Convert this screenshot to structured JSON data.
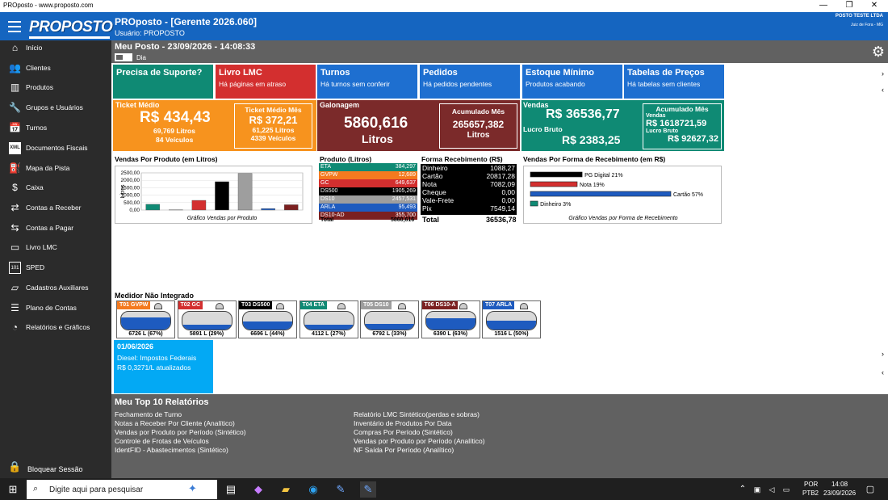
{
  "window": {
    "title": "PROposto - www.proposto.com",
    "minimize": "—",
    "maximize": "❐",
    "close": "✕"
  },
  "header": {
    "logo": "PROPOSTO",
    "title": "PROposto - [Gerente 2026.060]",
    "user": "Usuário: PROPOSTO",
    "company": "POSTO TESTE LTDA",
    "city": "Juiz de Fora - MG"
  },
  "sidebar": {
    "items": [
      {
        "label": "Início",
        "icon": "⌂"
      },
      {
        "label": "Clientes",
        "icon": "👥"
      },
      {
        "label": "Produtos",
        "icon": "▥"
      },
      {
        "label": "Grupos e Usuários",
        "icon": "🔧"
      },
      {
        "label": "Turnos",
        "icon": "📅"
      },
      {
        "label": "Documentos Fiscais",
        "icon": "XML"
      },
      {
        "label": "Mapa da Pista",
        "icon": "⛽"
      },
      {
        "label": "Caixa",
        "icon": "$"
      },
      {
        "label": "Contas a Receber",
        "icon": "⇄"
      },
      {
        "label": "Contas a Pagar",
        "icon": "⇆"
      },
      {
        "label": "Livro LMC",
        "icon": "▭"
      },
      {
        "label": "SPED",
        "icon": "101"
      },
      {
        "label": "Cadastros Auxiliares",
        "icon": "▱"
      },
      {
        "label": "Plano de Contas",
        "icon": "☰"
      },
      {
        "label": "Relatórios e Gráficos",
        "icon": "◔"
      }
    ],
    "lock": "Bloquear Sessão"
  },
  "dashboard": {
    "title": "Meu Posto - 23/09/2026 - 14:08:33",
    "toggle_label": "Dia"
  },
  "cards": [
    {
      "title": "Precisa de Suporte?",
      "sub": ""
    },
    {
      "title": "Livro LMC",
      "sub": "Há páginas em atraso"
    },
    {
      "title": "Turnos",
      "sub": "Há turnos sem conferir"
    },
    {
      "title": "Pedidos",
      "sub": "Há pedidos pendentes"
    },
    {
      "title": "Estoque Mínimo",
      "sub": "Produtos acabando"
    },
    {
      "title": "Tabelas de Preços",
      "sub": "Há tabelas sem clientes"
    }
  ],
  "ticket": {
    "label": "Ticket Médio",
    "value": "R$ 434,43",
    "litros": "69,769 Litros",
    "veiculos": "84 Veículos",
    "mes_label": "Ticket Médio Mês",
    "mes_value": "R$ 372,21",
    "mes_litros": "61,225 Litros",
    "mes_veiculos": "4339 Veículos"
  },
  "galonagem": {
    "label": "Galonagem",
    "value": "5860,616",
    "unit": "Litros",
    "mes_label": "Acumulado Mês",
    "mes_value": "265657,382",
    "mes_unit": "Litros"
  },
  "vendas": {
    "label": "Vendas",
    "value": "R$ 36536,77",
    "lucro_label": "Lucro Bruto",
    "lucro": "R$ 2383,25",
    "mes_label": "Acumulado Mês",
    "mes_vendas_label": "Vendas",
    "mes_vendas": "R$ 1618721,59",
    "mes_lucro_label": "Lucro Bruto",
    "mes_lucro": "R$ 92627,32"
  },
  "chart_produto": {
    "title": "Vendas Por Produto (em Litros)",
    "caption": "Gráfico Vendas por Produto"
  },
  "chart_data": [
    {
      "type": "bar",
      "title": "Vendas Por Produto (em Litros)",
      "ylabel": "Litros",
      "ylim": [
        0,
        2500
      ],
      "yticks": [
        "2500,00",
        "2000,00",
        "1500,00",
        "1000,00",
        "500,00",
        "0,00"
      ],
      "categories": [
        "ETA",
        "GVPW",
        "GC",
        "DS500",
        "DS10",
        "ARLA",
        "DS10-AD"
      ],
      "values": [
        384.297,
        12.689,
        649.637,
        1905.269,
        2457.531,
        95.493,
        355.7
      ],
      "colors": [
        "#0f8a74",
        "#f47a1f",
        "#d32f2f",
        "#000000",
        "#9e9e9e",
        "#1e5bbf",
        "#7b2020"
      ]
    },
    {
      "type": "bar",
      "orientation": "horizontal",
      "title": "Vendas Por Forma de Recebimento (em R$)",
      "categories": [
        "PG Digital",
        "Nota",
        "Cartão",
        "Dinheiro"
      ],
      "values": [
        21,
        19,
        57,
        3
      ],
      "unit": "%",
      "colors": [
        "#000000",
        "#d32f2f",
        "#1e5bbf",
        "#0f8a74"
      ]
    }
  ],
  "produto_table": {
    "title": "Produto (Litros)",
    "rows": [
      {
        "name": "ETA",
        "value": "384,297",
        "color": "#0f8a74"
      },
      {
        "name": "GVPW",
        "value": "12,689",
        "color": "#f47a1f"
      },
      {
        "name": "GC",
        "value": "649,637",
        "color": "#d32f2f"
      },
      {
        "name": "DS500",
        "value": "1905,269",
        "color": "#000000"
      },
      {
        "name": "DS10",
        "value": "2457,531",
        "color": "#9e9e9e"
      },
      {
        "name": "ARLA",
        "value": "95,493",
        "color": "#1e5bbf"
      },
      {
        "name": "DS10-AD",
        "value": "355,700",
        "color": "#7b2020"
      }
    ],
    "total_label": "Total",
    "total": "5860,616"
  },
  "forma_table": {
    "title": "Forma Recebimento (R$)",
    "rows": [
      {
        "name": "Dinheiro",
        "value": "1088,27"
      },
      {
        "name": "Cartão",
        "value": "20817,28"
      },
      {
        "name": "Nota",
        "value": "7082,09"
      },
      {
        "name": "Cheque",
        "value": "0,00"
      },
      {
        "name": "Vale-Frete",
        "value": "0,00"
      },
      {
        "name": "Pix",
        "value": "7549,14"
      }
    ],
    "total_label": "Total",
    "total": "36536,78"
  },
  "chart_forma": {
    "title": "Vendas Por Forma de Recebimento (em R$)",
    "caption": "Gráfico Vendas por Forma de Recebimento",
    "labels": [
      "PG Digital 21%",
      "Nota 19%",
      "Cartão 57%",
      "Dinheiro 3%"
    ]
  },
  "meter": {
    "title": "Medidor Não Integrado",
    "tanks": [
      {
        "name": "T01 GVPW",
        "color": "#f47a1f",
        "value": "6726 L (67%)",
        "level": 0.67
      },
      {
        "name": "T02 GC",
        "color": "#d32f2f",
        "value": "5891 L (29%)",
        "level": 0.29
      },
      {
        "name": "T03 DS500",
        "color": "#000000",
        "value": "6696 L (44%)",
        "level": 0.44
      },
      {
        "name": "T04 ETA",
        "color": "#0f8a74",
        "value": "4112 L (27%)",
        "level": 0.27
      },
      {
        "name": "T05 DS10",
        "color": "#9e9e9e",
        "value": "6792 L (33%)",
        "level": 0.33
      },
      {
        "name": "T06 DS10-A",
        "color": "#7b2020",
        "value": "6390 L (63%)",
        "level": 0.63
      },
      {
        "name": "T07 ARLA",
        "color": "#1e5bbf",
        "value": "1516 L (50%)",
        "level": 0.5
      }
    ]
  },
  "news": {
    "date": "01/06/2026",
    "line1": "Diesel: Impostos Federais",
    "line2": "R$ 0,3271/L atualizados"
  },
  "reports": {
    "title": "Meu Top 10 Relatórios",
    "left": [
      "Fechamento de Turno",
      "Notas a Receber Por Cliente (Analítico)",
      "Vendas por Produto por Período (Sintético)",
      "Controle de Frotas de Veículos",
      "IdentFID - Abastecimentos (Sintético)"
    ],
    "right": [
      "Relatório LMC Sintético(perdas e sobras)",
      "Inventário de Produtos Por Data",
      "Compras Por Período (Sintético)",
      "Vendas por Produto por Período (Analítico)",
      "NF Saída Por Período (Analítico)"
    ]
  },
  "taskbar": {
    "search_placeholder": "Digite aqui para pesquisar",
    "lang1": "POR",
    "lang2": "PTB2",
    "time": "14:08",
    "date": "23/09/2026"
  }
}
